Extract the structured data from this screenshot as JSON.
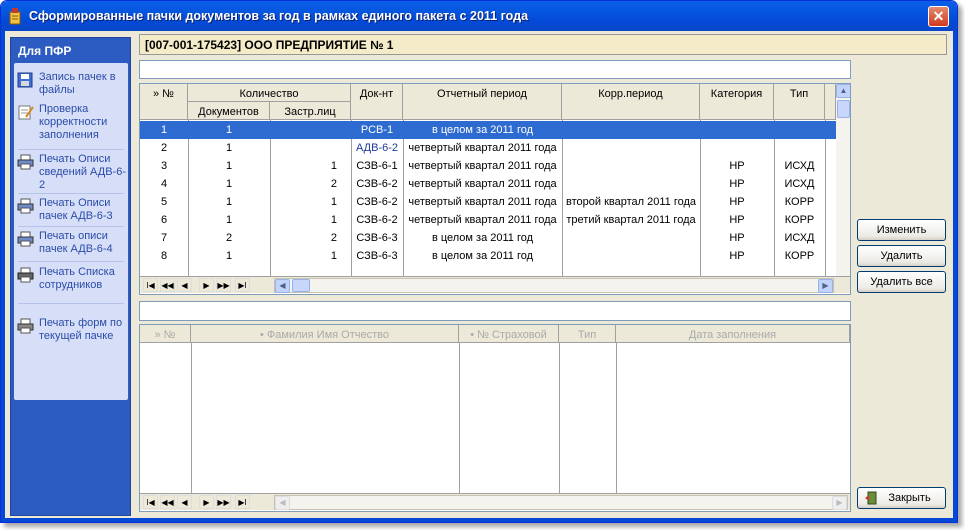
{
  "window": {
    "title": "Сформированные пачки документов за год в рамках единого пакета с 2011 года"
  },
  "left_panel": {
    "title": "Для ПФР",
    "items": [
      {
        "label": "Запись пачек в файлы",
        "icon": "floppy-disk-icon"
      },
      {
        "label": "Проверка корректности заполнения",
        "icon": "edit-document-icon"
      },
      {
        "label": "Печать Описи сведений АДВ-6-2",
        "icon": "printer-icon"
      },
      {
        "label": "Печать Описи пачек АДВ-6-3",
        "icon": "printer-icon"
      },
      {
        "label": "Печать описи пачек АДВ-6-4",
        "icon": "printer-icon"
      },
      {
        "label": "Печать Списка сотрудников",
        "icon": "printer-icon"
      },
      {
        "label": "Печать форм по текущей пачке",
        "icon": "printer-icon"
      }
    ]
  },
  "header": {
    "company": "[007-001-175423] ООО ПРЕДПРИЯТИЕ № 1"
  },
  "top_grid": {
    "columns": {
      "num": "» №",
      "quantity": "Количество",
      "docs": "Документов",
      "insured": "Застр.лиц",
      "doc": "Док-нт",
      "period": "Отчетный период",
      "corr": "Корр.период",
      "category": "Категория",
      "type": "Тип"
    },
    "rows": [
      {
        "num": "1",
        "docs": "1",
        "insured": "",
        "doc": "РСВ-1",
        "period": "в целом за 2011 год",
        "corr": "",
        "category": "",
        "type": ""
      },
      {
        "num": "2",
        "docs": "1",
        "insured": "",
        "doc": "АДВ-6-2",
        "period": "четвертый квартал 2011 года",
        "corr": "",
        "category": "",
        "type": ""
      },
      {
        "num": "3",
        "docs": "1",
        "insured": "1",
        "doc": "СЗВ-6-1",
        "period": "четвертый квартал 2011 года",
        "corr": "",
        "category": "НР",
        "type": "ИСХД"
      },
      {
        "num": "4",
        "docs": "1",
        "insured": "2",
        "doc": "СЗВ-6-2",
        "period": "четвертый квартал 2011 года",
        "corr": "",
        "category": "НР",
        "type": "ИСХД"
      },
      {
        "num": "5",
        "docs": "1",
        "insured": "1",
        "doc": "СЗВ-6-2",
        "period": "четвертый квартал 2011 года",
        "corr": "второй квартал 2011 года",
        "category": "НР",
        "type": "КОРР"
      },
      {
        "num": "6",
        "docs": "1",
        "insured": "1",
        "doc": "СЗВ-6-2",
        "period": "четвертый квартал 2011 года",
        "corr": "третий квартал 2011 года",
        "category": "НР",
        "type": "КОРР"
      },
      {
        "num": "7",
        "docs": "2",
        "insured": "2",
        "doc": "СЗВ-6-3",
        "period": "в целом за 2011 год",
        "corr": "",
        "category": "НР",
        "type": "ИСХД"
      },
      {
        "num": "8",
        "docs": "1",
        "insured": "1",
        "doc": "СЗВ-6-3",
        "period": "в целом за 2011 год",
        "corr": "",
        "category": "НР",
        "type": "КОРР"
      }
    ],
    "selected_row": 1
  },
  "bottom_grid": {
    "columns": {
      "num": "» №",
      "fio": "• Фамилия Имя Отчество",
      "snils": "• № Страховой",
      "type": "Тип",
      "date": "Дата заполнения"
    }
  },
  "nav": {
    "first": "I◀",
    "prev_page": "◀◀",
    "prev": "◀",
    "next": "▶",
    "next_page": "▶▶",
    "last": "▶I"
  },
  "buttons": {
    "edit": "Изменить",
    "delete": "Удалить",
    "delete_all": "Удалить все",
    "close": "Закрыть"
  }
}
